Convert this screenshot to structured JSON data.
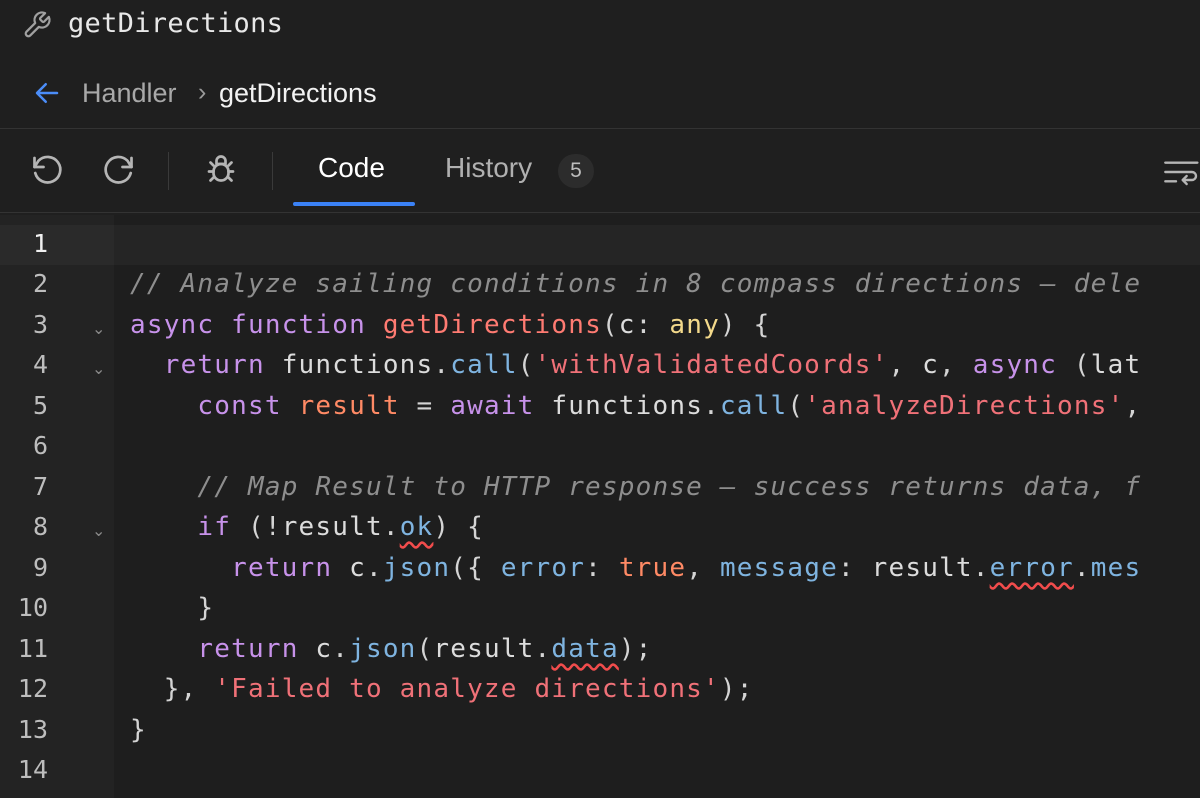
{
  "title": {
    "icon": "wrench-icon",
    "text": "getDirections"
  },
  "breadcrumb": {
    "back_icon": "arrow-left-icon",
    "parent": "Handler",
    "separator": "›",
    "current": "getDirections"
  },
  "toolbar": {
    "undo_icon": "undo-icon",
    "redo_icon": "redo-icon",
    "debug_icon": "bug-icon",
    "tabs": [
      {
        "label": "Code",
        "active": true
      },
      {
        "label": "History",
        "badge": "5"
      }
    ],
    "wrap_icon": "word-wrap-icon"
  },
  "editor": {
    "line_numbers": [
      "1",
      "2",
      "3",
      "4",
      "5",
      "6",
      "7",
      "8",
      "9",
      "10",
      "11",
      "12",
      "13",
      "14"
    ],
    "lines": [
      "",
      "// Analyze sailing conditions in 8 compass directions — dele",
      "async function getDirections(c: any) {",
      "  return functions.call('withValidatedCoords', c, async (lat",
      "    const result = await functions.call('analyzeDirections',",
      "",
      "    // Map Result to HTTP response — success returns data, f",
      "    if (!result.ok) {",
      "      return c.json({ error: true, message: result.error.mes",
      "    }",
      "    return c.json(result.data);",
      "  }, 'Failed to analyze directions');",
      "}",
      ""
    ],
    "accent": "#3b82f6"
  }
}
